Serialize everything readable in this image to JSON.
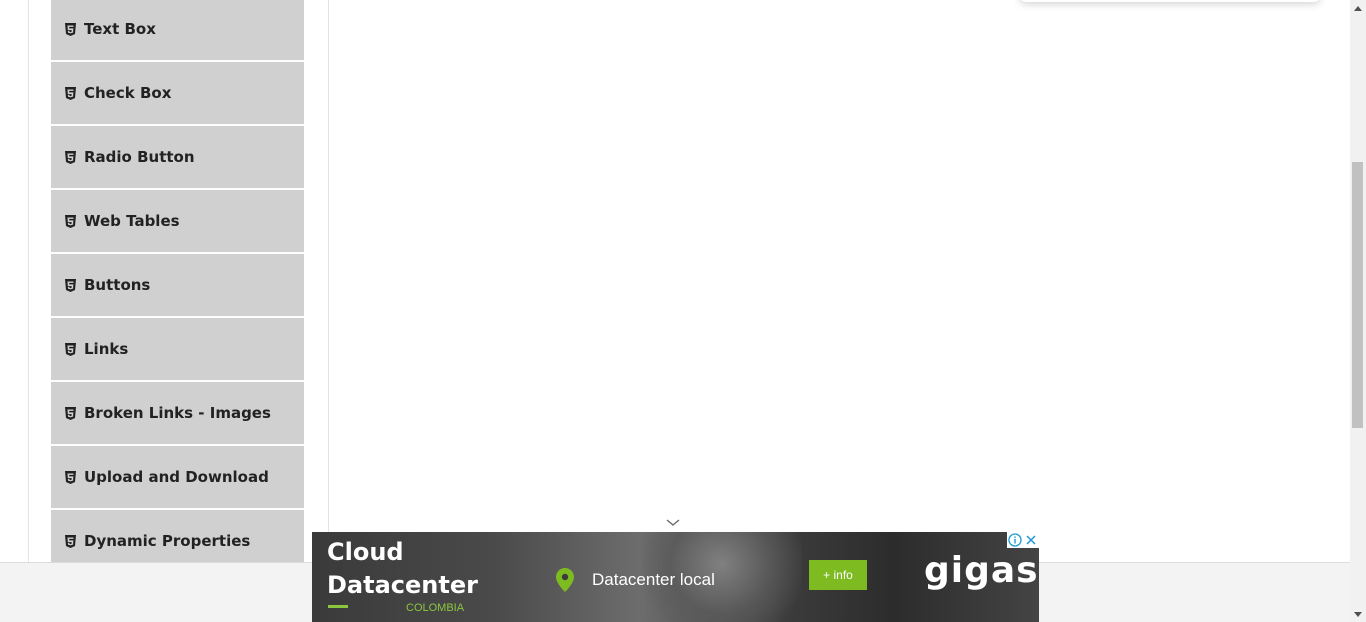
{
  "sidebar": {
    "items": [
      {
        "label": "Text Box",
        "icon": "html5-icon"
      },
      {
        "label": "Check Box",
        "icon": "html5-icon"
      },
      {
        "label": "Radio Button",
        "icon": "html5-icon"
      },
      {
        "label": "Web Tables",
        "icon": "html5-icon"
      },
      {
        "label": "Buttons",
        "icon": "html5-icon"
      },
      {
        "label": "Links",
        "icon": "html5-icon"
      },
      {
        "label": "Broken Links - Images",
        "icon": "html5-icon"
      },
      {
        "label": "Upload and Download",
        "icon": "html5-icon"
      },
      {
        "label": "Dynamic Properties",
        "icon": "html5-icon"
      }
    ]
  },
  "ad": {
    "title_line1": "Cloud",
    "title_line2": "Datacenter",
    "country": "COLOMBIA",
    "location": "Datacenter local",
    "button_label": "+ info",
    "brand": "gigas",
    "accent_color": "#7dbb21"
  }
}
